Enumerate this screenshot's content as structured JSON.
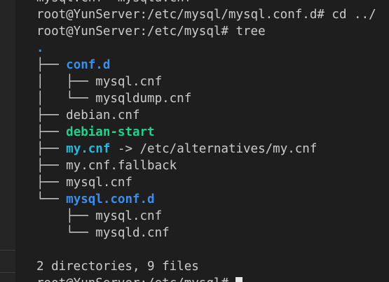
{
  "terminal": {
    "lines": [
      {
        "segments": [
          {
            "text": "mysql.cnf  mysqld.cnf",
            "style": "normal"
          }
        ]
      },
      {
        "segments": [
          {
            "text": "root@YunServer:/etc/mysql/mysql.conf.d# cd ../",
            "style": "normal"
          }
        ]
      },
      {
        "segments": [
          {
            "text": "root@YunServer:/etc/mysql# tree",
            "style": "normal"
          }
        ]
      },
      {
        "segments": [
          {
            "text": ".",
            "style": "dot"
          }
        ]
      },
      {
        "segments": [
          {
            "text": "├── ",
            "style": "normal"
          },
          {
            "text": "conf.d",
            "style": "dir"
          }
        ]
      },
      {
        "segments": [
          {
            "text": "│   ├── mysql.cnf",
            "style": "normal"
          }
        ]
      },
      {
        "segments": [
          {
            "text": "│   └── mysqldump.cnf",
            "style": "normal"
          }
        ]
      },
      {
        "segments": [
          {
            "text": "├── debian.cnf",
            "style": "normal"
          }
        ]
      },
      {
        "segments": [
          {
            "text": "├── ",
            "style": "normal"
          },
          {
            "text": "debian-start",
            "style": "exec"
          }
        ]
      },
      {
        "segments": [
          {
            "text": "├── ",
            "style": "normal"
          },
          {
            "text": "my.cnf",
            "style": "link"
          },
          {
            "text": " -> /etc/alternatives/my.cnf",
            "style": "normal"
          }
        ]
      },
      {
        "segments": [
          {
            "text": "├── my.cnf.fallback",
            "style": "normal"
          }
        ]
      },
      {
        "segments": [
          {
            "text": "├── mysql.cnf",
            "style": "normal"
          }
        ]
      },
      {
        "segments": [
          {
            "text": "└── ",
            "style": "normal"
          },
          {
            "text": "mysql.conf.d",
            "style": "dir"
          }
        ]
      },
      {
        "segments": [
          {
            "text": "    ├── mysql.cnf",
            "style": "normal"
          }
        ]
      },
      {
        "segments": [
          {
            "text": "    └── mysqld.cnf",
            "style": "normal"
          }
        ]
      },
      {
        "segments": [
          {
            "text": "",
            "style": "normal"
          }
        ]
      },
      {
        "segments": [
          {
            "text": "2 directories, 9 files",
            "style": "normal"
          }
        ]
      },
      {
        "segments": [
          {
            "text": "root@YunServer:/etc/mysql# ",
            "style": "normal"
          }
        ],
        "cursor": true
      }
    ]
  },
  "colors": {
    "background": "#1e1e1e",
    "text": "#cccccc",
    "directory": "#3b8eea",
    "executable": "#23d18b",
    "symlink": "#29b8db"
  }
}
